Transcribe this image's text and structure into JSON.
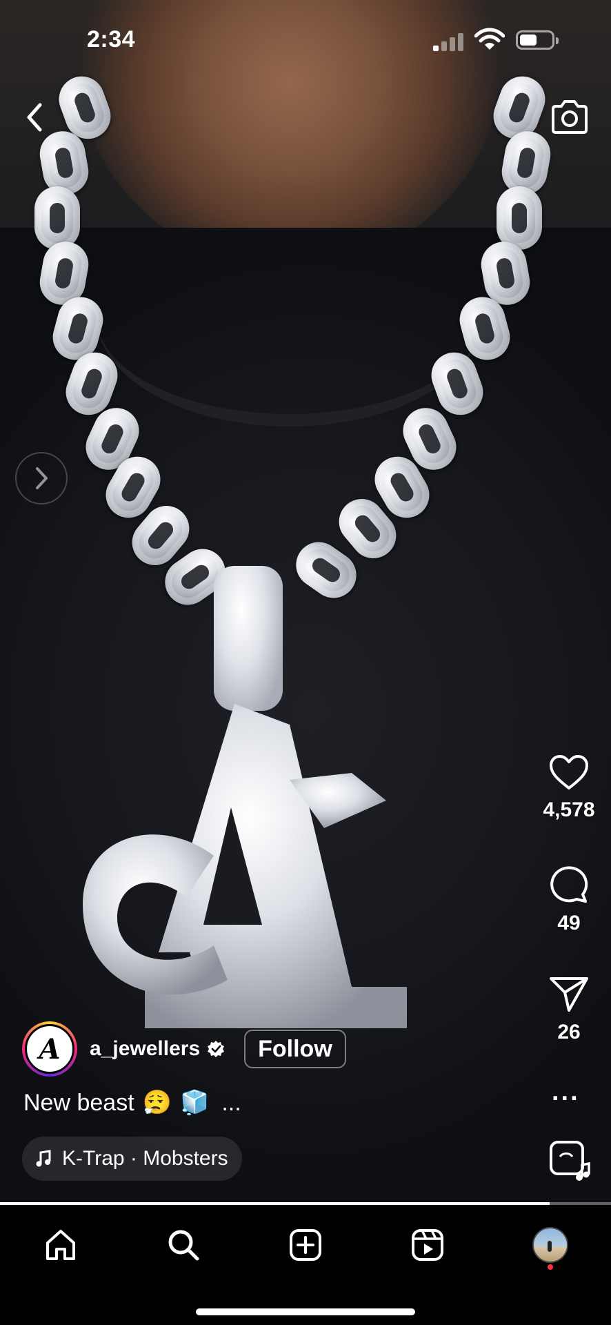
{
  "status_bar": {
    "time": "2:34"
  },
  "post": {
    "username": "a_jewellers",
    "avatar_letter": "A",
    "follow_label": "Follow",
    "caption_text": "New beast",
    "caption_emojis": [
      "😮‍💨",
      "🧊"
    ],
    "caption_more": "...",
    "audio": "K-Trap · Mobsters",
    "progress_fraction": 0.9
  },
  "actions": {
    "likes": "4,578",
    "comments": "49",
    "shares": "26",
    "more": "..."
  },
  "icons": {
    "back": "chevron-left-icon",
    "camera": "camera-icon",
    "next": "chevron-right-icon",
    "like": "heart-icon",
    "comment": "comment-bubble-icon",
    "share": "paper-plane-icon",
    "audio": "audio-page-icon",
    "tabs": [
      "home-icon",
      "search-icon",
      "create-icon",
      "reels-icon",
      "profile-avatar"
    ]
  },
  "colors": {
    "background": "#000000",
    "notification_dot": "#ff3040"
  }
}
